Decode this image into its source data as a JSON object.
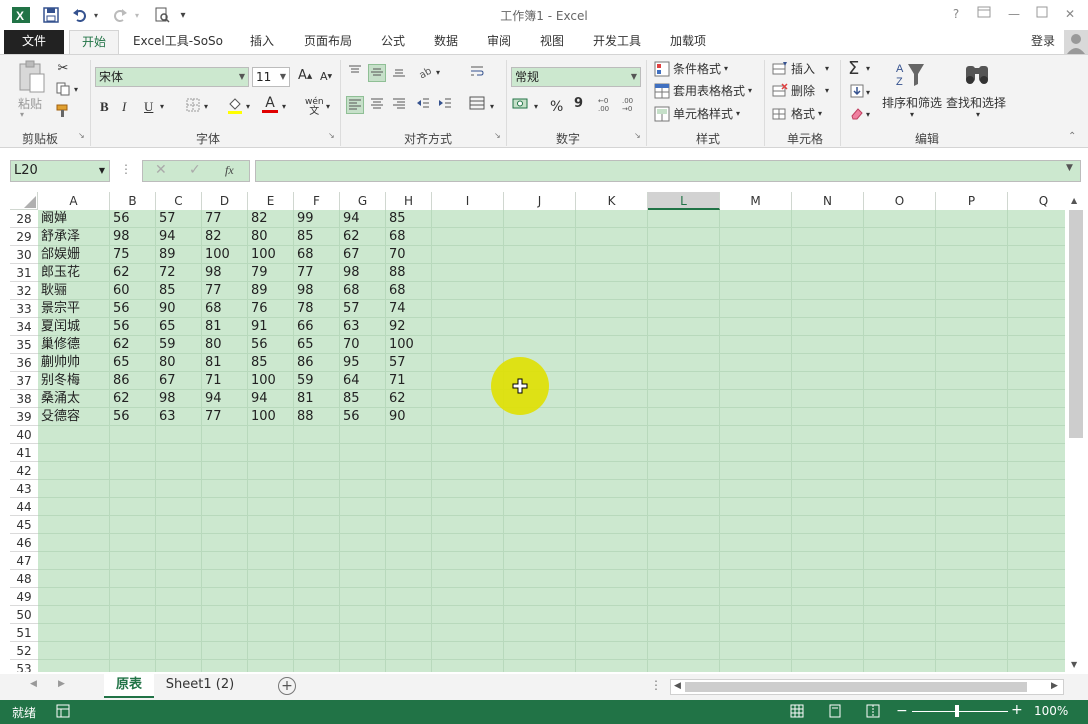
{
  "window": {
    "title": "工作簿1 - Excel",
    "help_icon": "?",
    "login": "登录"
  },
  "tabs": [
    {
      "label": "文件"
    },
    {
      "label": "开始"
    },
    {
      "label": "Excel工具-SoSo"
    },
    {
      "label": "插入"
    },
    {
      "label": "页面布局"
    },
    {
      "label": "公式"
    },
    {
      "label": "数据"
    },
    {
      "label": "审阅"
    },
    {
      "label": "视图"
    },
    {
      "label": "开发工具"
    },
    {
      "label": "加载项"
    }
  ],
  "ribbon": {
    "clipboard": {
      "paste": "粘贴",
      "group": "剪贴板"
    },
    "font": {
      "name": "宋体",
      "size": "11",
      "bold": "B",
      "italic": "I",
      "underline": "U",
      "group": "字体",
      "grow": "A",
      "shrink": "A",
      "font_color": "A",
      "phonetic": "wén"
    },
    "alignment": {
      "group": "对齐方式"
    },
    "number": {
      "format": "常规",
      "percent": "%",
      "comma": "9",
      "group": "数字"
    },
    "styles": {
      "conditional": "条件格式",
      "table": "套用表格格式",
      "cell": "单元格样式",
      "group": "样式"
    },
    "cells": {
      "insert": "插入",
      "delete": "删除",
      "format": "格式",
      "group": "单元格"
    },
    "editing": {
      "sort": "排序和筛选",
      "find": "查找和选择",
      "group": "编辑"
    }
  },
  "formula_bar": {
    "name_box": "L20",
    "fx": "fx",
    "formula": ""
  },
  "columns": [
    "A",
    "B",
    "C",
    "D",
    "E",
    "F",
    "G",
    "H",
    "I",
    "J",
    "K",
    "L",
    "M",
    "N",
    "O",
    "P",
    "Q"
  ],
  "selected_column": "L",
  "rows": [
    {
      "num": "28",
      "cells": [
        "阚婵",
        "56",
        "57",
        "77",
        "82",
        "99",
        "94",
        "85"
      ]
    },
    {
      "num": "29",
      "cells": [
        "舒承泽",
        "98",
        "94",
        "82",
        "80",
        "85",
        "62",
        "68"
      ]
    },
    {
      "num": "30",
      "cells": [
        "郃娱姗",
        "75",
        "89",
        "100",
        "100",
        "68",
        "67",
        "70"
      ]
    },
    {
      "num": "31",
      "cells": [
        "郎玉花",
        "62",
        "72",
        "98",
        "79",
        "77",
        "98",
        "88"
      ]
    },
    {
      "num": "32",
      "cells": [
        "耿骊",
        "60",
        "85",
        "77",
        "89",
        "98",
        "68",
        "68"
      ]
    },
    {
      "num": "33",
      "cells": [
        "景宗平",
        "56",
        "90",
        "68",
        "76",
        "78",
        "57",
        "74"
      ]
    },
    {
      "num": "34",
      "cells": [
        "夏闰城",
        "56",
        "65",
        "81",
        "91",
        "66",
        "63",
        "92"
      ]
    },
    {
      "num": "35",
      "cells": [
        "巢修德",
        "62",
        "59",
        "80",
        "56",
        "65",
        "70",
        "100"
      ]
    },
    {
      "num": "36",
      "cells": [
        "蒯帅帅",
        "65",
        "80",
        "81",
        "85",
        "86",
        "95",
        "57"
      ]
    },
    {
      "num": "37",
      "cells": [
        "别冬梅",
        "86",
        "67",
        "71",
        "100",
        "59",
        "64",
        "71"
      ]
    },
    {
      "num": "38",
      "cells": [
        "桑涌太",
        "62",
        "98",
        "94",
        "94",
        "81",
        "85",
        "62"
      ]
    },
    {
      "num": "39",
      "cells": [
        "殳德容",
        "56",
        "63",
        "77",
        "100",
        "88",
        "56",
        "90"
      ]
    },
    {
      "num": "40",
      "cells": []
    },
    {
      "num": "41",
      "cells": []
    },
    {
      "num": "42",
      "cells": []
    },
    {
      "num": "43",
      "cells": []
    },
    {
      "num": "44",
      "cells": []
    },
    {
      "num": "45",
      "cells": []
    },
    {
      "num": "46",
      "cells": []
    },
    {
      "num": "47",
      "cells": []
    },
    {
      "num": "48",
      "cells": []
    },
    {
      "num": "49",
      "cells": []
    },
    {
      "num": "50",
      "cells": []
    },
    {
      "num": "51",
      "cells": []
    },
    {
      "num": "52",
      "cells": []
    },
    {
      "num": "53",
      "cells": []
    }
  ],
  "sheets": [
    {
      "label": "原表",
      "active": true
    },
    {
      "label": "Sheet1 (2)",
      "active": false
    }
  ],
  "status": {
    "ready": "就绪",
    "zoom": "100%"
  },
  "colors": {
    "accent": "#217346",
    "grid_bg": "#cce8cf",
    "cursor_highlight": "#e0e000"
  }
}
